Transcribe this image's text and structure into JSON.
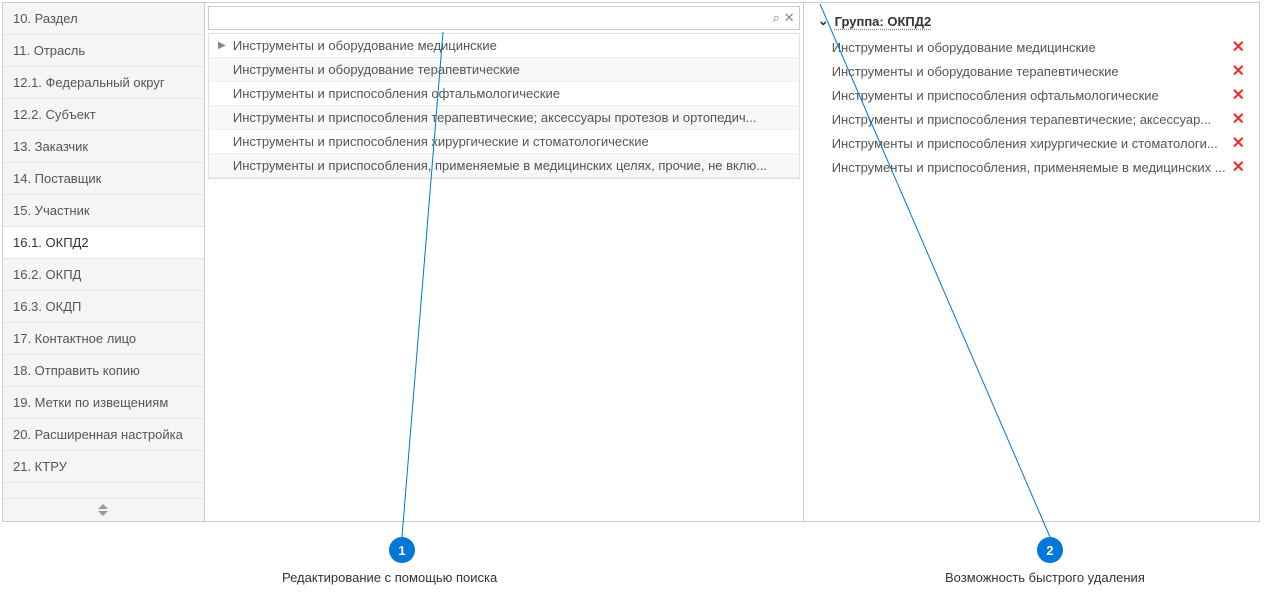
{
  "sidebar": {
    "items": [
      {
        "label": "10. Раздел"
      },
      {
        "label": "11. Отрасль"
      },
      {
        "label": "12.1. Федеральный округ"
      },
      {
        "label": "12.2. Субъект"
      },
      {
        "label": "13. Заказчик"
      },
      {
        "label": "14. Поставщик"
      },
      {
        "label": "15. Участник"
      },
      {
        "label": "16.1. ОКПД2",
        "active": true
      },
      {
        "label": "16.2. ОКПД"
      },
      {
        "label": "16.3. ОКДП"
      },
      {
        "label": "17. Контактное лицо"
      },
      {
        "label": "18. Отправить копию"
      },
      {
        "label": "19. Метки по извещениям"
      },
      {
        "label": "20. Расширенная настройка"
      },
      {
        "label": "21. КТРУ"
      }
    ]
  },
  "search": {
    "placeholder": "",
    "value": ""
  },
  "results": [
    {
      "expandable": true,
      "text": "Инструменты и оборудование медицинские"
    },
    {
      "expandable": false,
      "text": "Инструменты и оборудование терапевтические"
    },
    {
      "expandable": false,
      "text": "Инструменты и приспособления офтальмологические"
    },
    {
      "expandable": false,
      "text": "Инструменты и приспособления терапевтические; аксессуары протезов и ортопедич..."
    },
    {
      "expandable": false,
      "text": "Инструменты и приспособления хирургические и стоматологические"
    },
    {
      "expandable": false,
      "text": "Инструменты и приспособления, применяемые в медицинских целях, прочие, не вклю..."
    }
  ],
  "group": {
    "title": "Группа: ОКПД2",
    "items": [
      "Инструменты и оборудование медицинские",
      "Инструменты и оборудование терапевтические",
      "Инструменты и приспособления офтальмологические",
      "Инструменты и приспособления терапевтические; аксессуар...",
      "Инструменты и приспособления хирургические и стоматологи...",
      "Инструменты и приспособления, применяемые в медицинских ..."
    ]
  },
  "callouts": {
    "marker1": "1",
    "label1": "Редактирование с помощью поиска",
    "marker2": "2",
    "label2": "Возможность быстрого удаления"
  }
}
